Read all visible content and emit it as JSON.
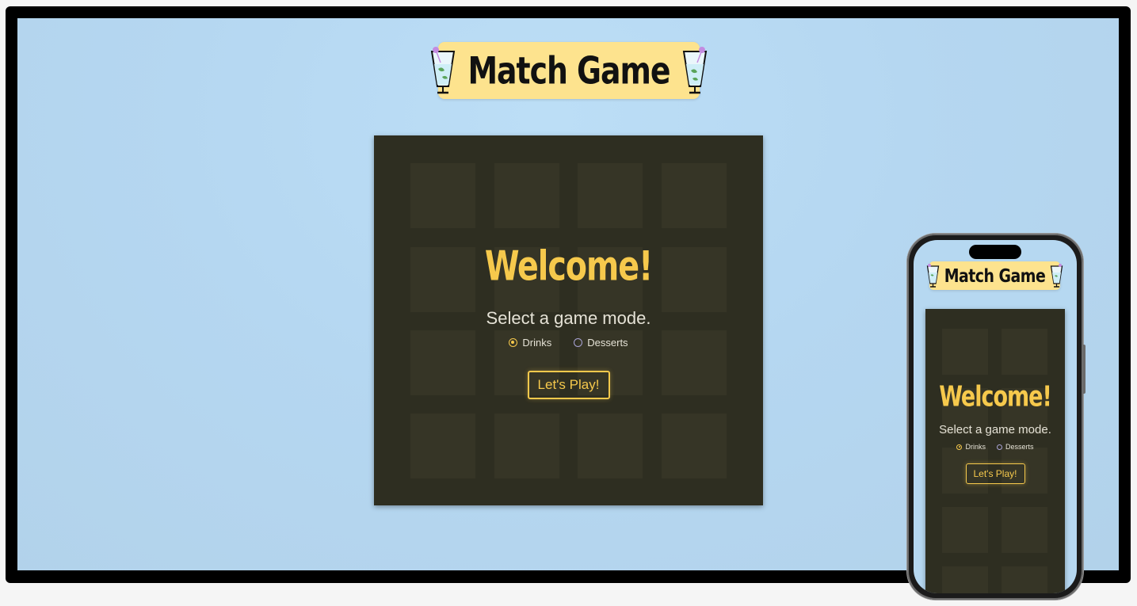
{
  "app": {
    "title": "Match Game",
    "icon": "cocktail-glass-icon"
  },
  "welcome": {
    "heading": "Welcome!",
    "prompt": "Select a game mode.",
    "modes": [
      {
        "label": "Drinks",
        "selected": true
      },
      {
        "label": "Desserts",
        "selected": false
      }
    ],
    "play_button": "Let's Play!"
  },
  "board": {
    "desktop_grid": {
      "rows": 4,
      "columns": 4
    },
    "mobile_grid": {
      "rows": 5,
      "columns": 2
    }
  },
  "colors": {
    "background": "#b5d7f1",
    "title_badge": "#fde38e",
    "board": "#2e2e21",
    "tile": "#363526",
    "accent": "#f6c94c",
    "text": "#e5e2d6",
    "radio_unchecked": "#a9a4d6"
  }
}
